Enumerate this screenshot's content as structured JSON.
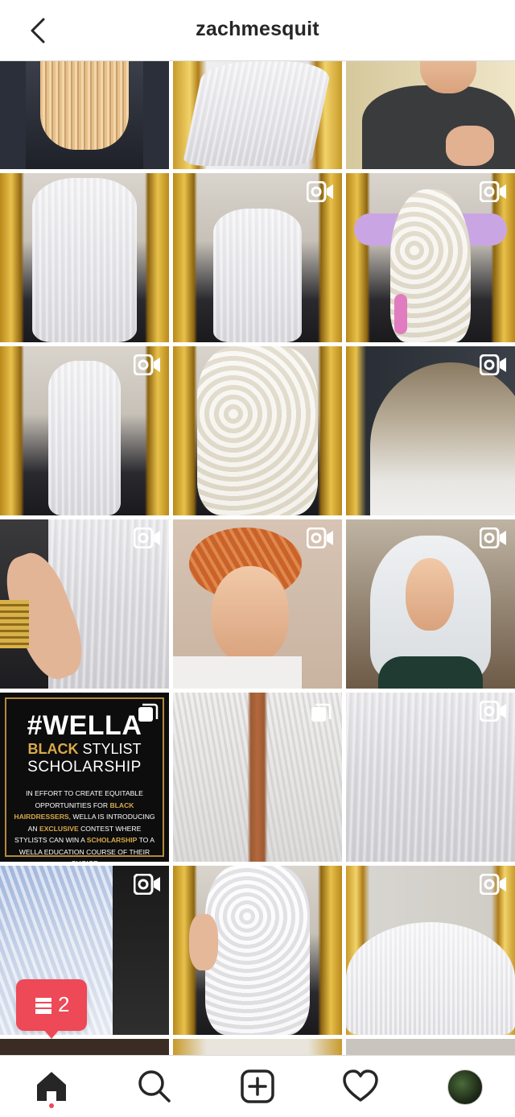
{
  "header": {
    "title": "zachmesquit"
  },
  "icons": {
    "back": "chevron-left-icon",
    "video": "video-camera-icon",
    "multi": "carousel-icon",
    "home": "home-icon",
    "search": "search-icon",
    "new_post": "plus-square-icon",
    "activity": "heart-icon",
    "profile": "avatar"
  },
  "wella_post": {
    "headline": "#WELLA",
    "line2_accent": "BLACK",
    "line2_rest": "STYLIST",
    "line3": "SCHOLARSHIP",
    "body_1": "In effort to create equitable opportunities for",
    "body_black_hair": "Black Hairdressers",
    "body_2": ", Wella is introducing an",
    "body_exclusive": "exclusive",
    "body_3": "contest where stylists can win a",
    "body_scholarship": "scholarship",
    "body_4": "to a Wella Education Course of their choice"
  },
  "notification_badge": {
    "count": "2"
  },
  "colors": {
    "accent": "#ed4956",
    "border": "#dbdbdb",
    "text": "#262626",
    "gold": "#d9a94a"
  }
}
